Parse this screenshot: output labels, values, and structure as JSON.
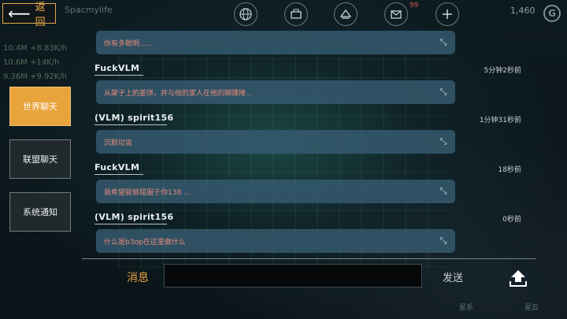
{
  "header": {
    "back_label": "返回",
    "player_name": "Spacmylife",
    "mail_count": "99",
    "score": "1,460",
    "icons": [
      "globe-icon",
      "building-icon",
      "fleet-icon",
      "mail-icon",
      "add-icon"
    ]
  },
  "resources": [
    "10.4M +8.83K/h",
    "10.6M +14K/h",
    "9.36M +9.92K/h"
  ],
  "tabs": [
    {
      "label": "世界聊天",
      "active": true
    },
    {
      "label": "联盟聊天",
      "active": false
    },
    {
      "label": "系统通知",
      "active": false
    }
  ],
  "messages": [
    {
      "sender": "",
      "time": "",
      "text": "你有多聪明......"
    },
    {
      "sender": "FuckVLM",
      "time": "5分钟2秒前",
      "text": "从架子上的姜饼，并与他的家人在他的脚踝捲..."
    },
    {
      "sender": "(VLM) spirit156",
      "time": "1分钟31秒前",
      "text": "沉默垃圾"
    },
    {
      "sender": "FuckVLM",
      "time": "18秒前",
      "text": "我希望能够屈服于你138 ..."
    },
    {
      "sender": "(VLM) spirit156",
      "time": "0秒前",
      "text": "什么是b3op在这里做什么"
    }
  ],
  "input": {
    "label": "消息",
    "value": "",
    "send_label": "发送"
  },
  "bottom_nav": [
    "星系",
    "星云"
  ],
  "colors": {
    "accent": "#e8a33a",
    "message_bg": "#365c70",
    "message_text": "#e98b7c"
  }
}
